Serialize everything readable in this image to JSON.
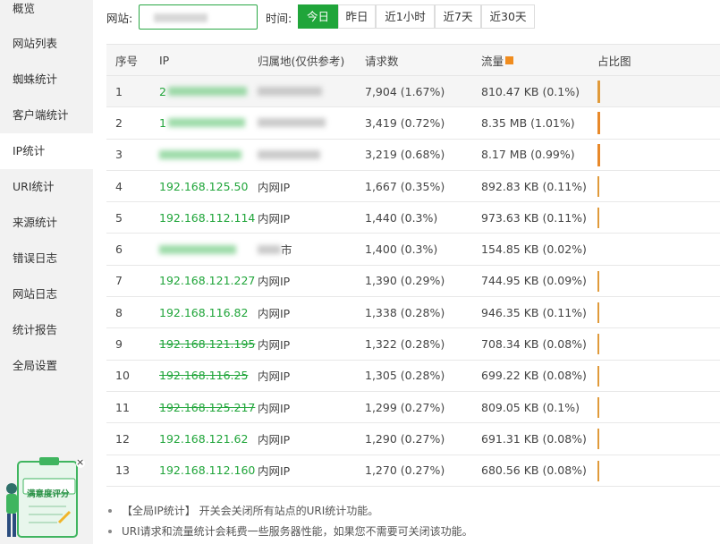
{
  "sidebar": {
    "items": [
      {
        "label": "概览"
      },
      {
        "label": "网站列表"
      },
      {
        "label": "蜘蛛统计"
      },
      {
        "label": "客户端统计"
      },
      {
        "label": "IP统计"
      },
      {
        "label": "URI统计"
      },
      {
        "label": "来源统计"
      },
      {
        "label": "错误日志"
      },
      {
        "label": "网站日志"
      },
      {
        "label": "统计报告"
      },
      {
        "label": "全局设置"
      }
    ],
    "active_index": 4
  },
  "promo": {
    "label": "满意度评分",
    "close": "×"
  },
  "toolbar": {
    "site_label": "网站:",
    "time_label": "时间:",
    "ranges": [
      {
        "label": "今日",
        "active": true
      },
      {
        "label": "昨日",
        "active": false
      },
      {
        "label": "近1小时",
        "active": false
      },
      {
        "label": "近7天",
        "active": false
      },
      {
        "label": "近30天",
        "active": false
      }
    ]
  },
  "table": {
    "headers": {
      "no": "序号",
      "ip": "IP",
      "location": "归属地(仅供参考)",
      "requests": "请求数",
      "traffic": "流量",
      "ratio": "占比图"
    },
    "rows": [
      {
        "no": "1",
        "ip": "2",
        "location": "",
        "requests": "7,904 (1.67%)",
        "traffic": "810.47 KB (0.1%)",
        "bar": 0.1
      },
      {
        "no": "2",
        "ip": "1",
        "location": "",
        "requests": "3,419 (0.72%)",
        "traffic": "8.35 MB (1.01%)",
        "bar": 1.01
      },
      {
        "no": "3",
        "ip": "",
        "location": "",
        "requests": "3,219 (0.68%)",
        "traffic": "8.17 MB (0.99%)",
        "bar": 0.99
      },
      {
        "no": "4",
        "ip": "192.168.125.50",
        "location": "内网IP",
        "requests": "1,667 (0.35%)",
        "traffic": "892.83 KB (0.11%)",
        "bar": 0.11
      },
      {
        "no": "5",
        "ip": "192.168.112.114",
        "location": "内网IP",
        "requests": "1,440 (0.3%)",
        "traffic": "973.63 KB (0.11%)",
        "bar": 0.11
      },
      {
        "no": "6",
        "ip": "",
        "location": "市",
        "requests": "1,400 (0.3%)",
        "traffic": "154.85 KB (0.02%)",
        "bar": 0.02
      },
      {
        "no": "7",
        "ip": "192.168.121.227",
        "location": "内网IP",
        "requests": "1,390 (0.29%)",
        "traffic": "744.95 KB (0.09%)",
        "bar": 0.09
      },
      {
        "no": "8",
        "ip": "192.168.116.82",
        "location": "内网IP",
        "requests": "1,338 (0.28%)",
        "traffic": "946.35 KB (0.11%)",
        "bar": 0.11
      },
      {
        "no": "9",
        "ip": "192.168.121.195",
        "location": "内网IP",
        "requests": "1,322 (0.28%)",
        "traffic": "708.34 KB (0.08%)",
        "bar": 0.08
      },
      {
        "no": "10",
        "ip": "192.168.116.25",
        "location": "内网IP",
        "requests": "1,305 (0.28%)",
        "traffic": "699.22 KB (0.08%)",
        "bar": 0.08
      },
      {
        "no": "11",
        "ip": "192.168.125.217",
        "location": "内网IP",
        "requests": "1,299 (0.27%)",
        "traffic": "809.05 KB (0.1%)",
        "bar": 0.1
      },
      {
        "no": "12",
        "ip": "192.168.121.62",
        "location": "内网IP",
        "requests": "1,290 (0.27%)",
        "traffic": "691.31 KB (0.08%)",
        "bar": 0.08
      },
      {
        "no": "13",
        "ip": "192.168.112.160",
        "location": "内网IP",
        "requests": "1,270 (0.27%)",
        "traffic": "680.56 KB (0.08%)",
        "bar": 0.08
      }
    ]
  },
  "notes": [
    "【全局IP统计】 开关会关闭所有站点的URI统计功能。",
    "URI请求和流量统计会耗费一些服务器性能，如果您不需要可关闭该功能。"
  ],
  "colors": {
    "accent": "#20a53a",
    "bar": "#e09a3a",
    "traffic_marker": "#f08c1e"
  }
}
